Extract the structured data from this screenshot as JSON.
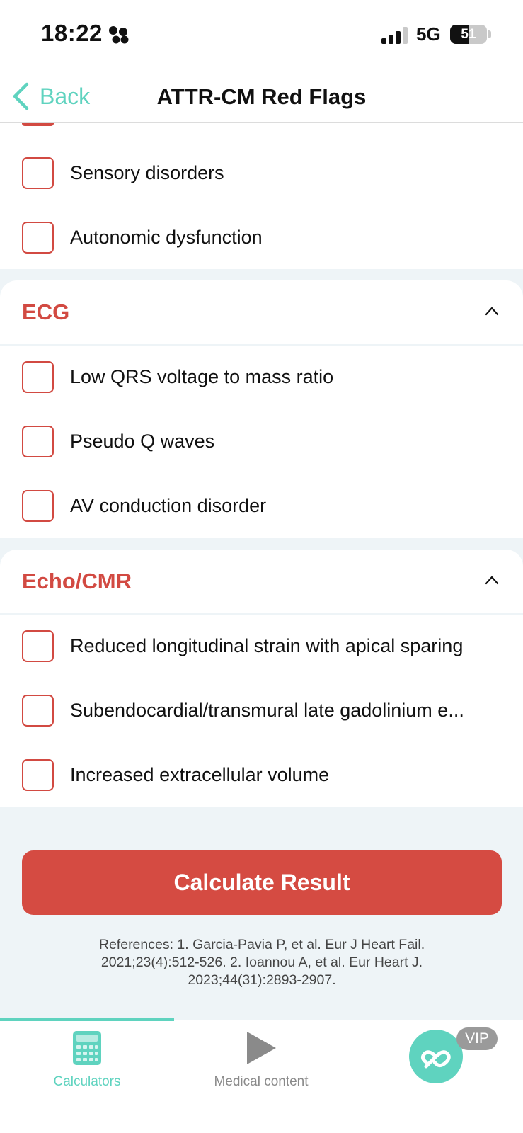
{
  "status": {
    "time": "18:22",
    "network": "5G",
    "battery": "51",
    "battery_fraction": 0.51
  },
  "nav": {
    "back_label": "Back",
    "title": "ATTR-CM Red Flags"
  },
  "top_items": [
    {
      "label": "Sensory disorders"
    },
    {
      "label": "Autonomic dysfunction"
    }
  ],
  "sections": [
    {
      "title": "ECG",
      "items": [
        {
          "label": "Low QRS voltage to mass ratio"
        },
        {
          "label": "Pseudo Q waves"
        },
        {
          "label": "AV conduction disorder"
        }
      ]
    },
    {
      "title": "Echo/CMR",
      "items": [
        {
          "label": "Reduced longitudinal strain with apical sparing"
        },
        {
          "label": "Subendocardial/transmural late gadolinium e..."
        },
        {
          "label": "Increased extracellular volume"
        }
      ]
    }
  ],
  "actions": {
    "calculate_label": "Calculate Result"
  },
  "references": "References: 1. Garcia-Pavia P, et al. Eur J Heart Fail. 2021;23(4):512-526. 2. Ioannou A, et al. Eur Heart J. 2023;44(31):2893-2907.",
  "tabbar": {
    "tabs": [
      {
        "label": "Calculators",
        "icon": "calculator-icon",
        "active": true
      },
      {
        "label": "Medical content",
        "icon": "play-icon",
        "active": false
      }
    ],
    "vip_label": "VIP"
  },
  "colors": {
    "accent": "#5fd3bf",
    "danger": "#d54b42",
    "section_title": "#d24a42",
    "background": "#eef4f7"
  }
}
